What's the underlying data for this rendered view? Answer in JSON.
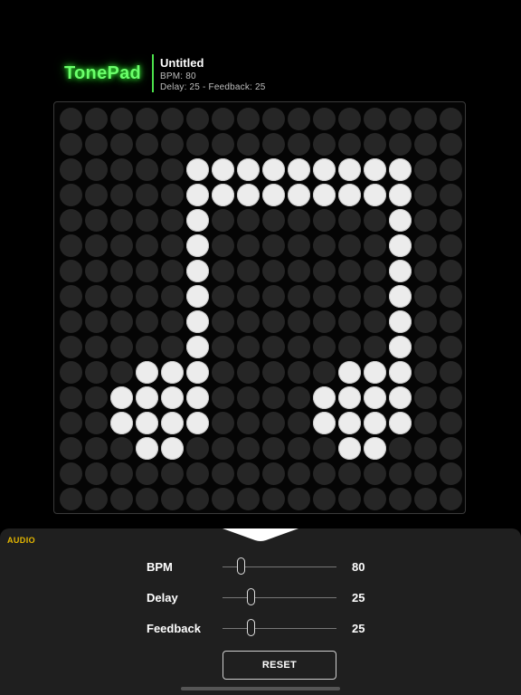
{
  "app": {
    "logo": "TonePad"
  },
  "song": {
    "title": "Untitled",
    "bpm_line": "BPM: 80",
    "delay_feedback_line": "Delay: 25 - Feedback: 25"
  },
  "grid": {
    "columns": 16,
    "rows": 16,
    "active_cells": [
      [
        2,
        5
      ],
      [
        2,
        6
      ],
      [
        2,
        7
      ],
      [
        2,
        8
      ],
      [
        2,
        9
      ],
      [
        2,
        10
      ],
      [
        2,
        11
      ],
      [
        2,
        12
      ],
      [
        2,
        13
      ],
      [
        3,
        5
      ],
      [
        3,
        6
      ],
      [
        3,
        7
      ],
      [
        3,
        8
      ],
      [
        3,
        9
      ],
      [
        3,
        10
      ],
      [
        3,
        11
      ],
      [
        3,
        12
      ],
      [
        3,
        13
      ],
      [
        4,
        5
      ],
      [
        4,
        13
      ],
      [
        5,
        5
      ],
      [
        5,
        13
      ],
      [
        6,
        5
      ],
      [
        6,
        13
      ],
      [
        7,
        5
      ],
      [
        7,
        13
      ],
      [
        8,
        5
      ],
      [
        8,
        13
      ],
      [
        9,
        5
      ],
      [
        9,
        13
      ],
      [
        10,
        3
      ],
      [
        10,
        4
      ],
      [
        10,
        5
      ],
      [
        10,
        11
      ],
      [
        10,
        12
      ],
      [
        10,
        13
      ],
      [
        11,
        2
      ],
      [
        11,
        3
      ],
      [
        11,
        4
      ],
      [
        11,
        5
      ],
      [
        11,
        10
      ],
      [
        11,
        11
      ],
      [
        11,
        12
      ],
      [
        11,
        13
      ],
      [
        12,
        2
      ],
      [
        12,
        3
      ],
      [
        12,
        4
      ],
      [
        12,
        5
      ],
      [
        12,
        10
      ],
      [
        12,
        11
      ],
      [
        12,
        12
      ],
      [
        12,
        13
      ],
      [
        13,
        3
      ],
      [
        13,
        4
      ],
      [
        13,
        11
      ],
      [
        13,
        12
      ]
    ],
    "colors": {
      "on": "#ececec",
      "off": "#262626"
    }
  },
  "audio_panel": {
    "section_label": "AUDIO",
    "sliders": [
      {
        "label": "BPM",
        "value": "80",
        "level": 0.17
      },
      {
        "label": "Delay",
        "value": "25",
        "level": 0.25
      },
      {
        "label": "Feedback",
        "value": "25",
        "level": 0.25
      }
    ],
    "reset_label": "RESET"
  },
  "colors": {
    "logo_glow": "#6bff6b",
    "accent_section": "#e6b800",
    "panel_bg": "#1f1f1f"
  }
}
